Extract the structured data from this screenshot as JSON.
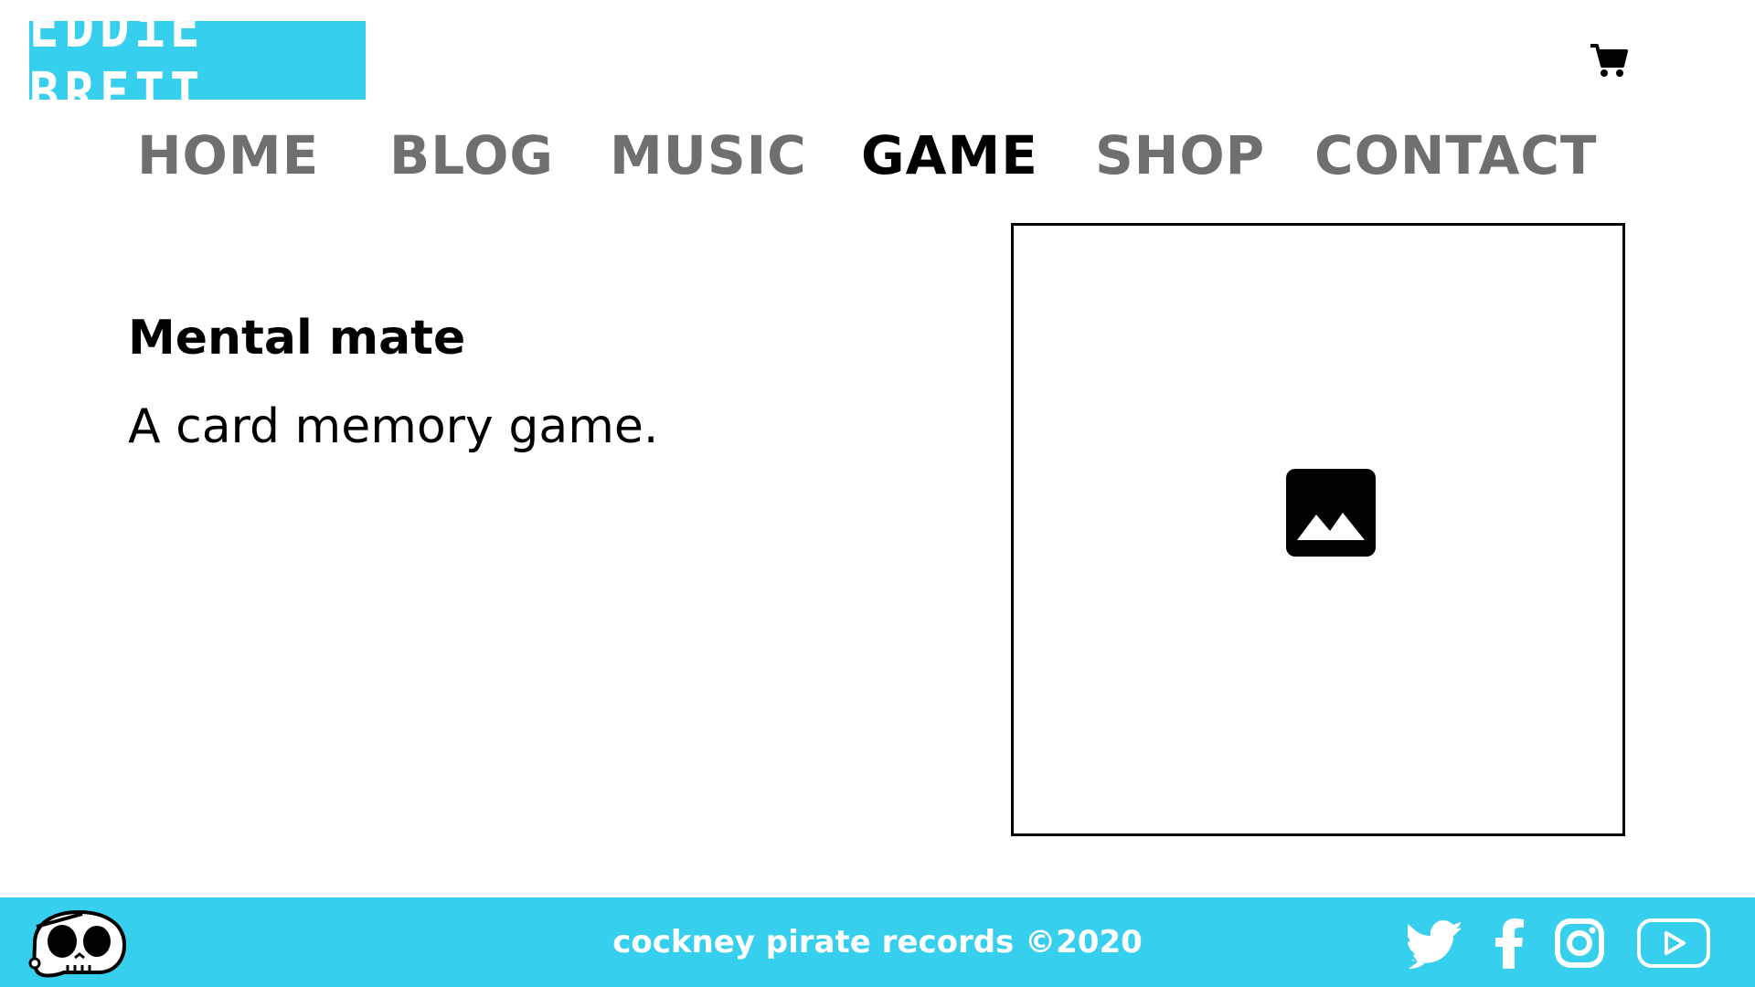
{
  "header": {
    "logo_text": "EDDiE BRETT",
    "cart_icon": "cart-icon",
    "brand_color": "#37cfee"
  },
  "nav": {
    "items": [
      {
        "label": "HOME",
        "active": false
      },
      {
        "label": "BLOG",
        "active": false
      },
      {
        "label": "MUSIC",
        "active": false
      },
      {
        "label": "GAME",
        "active": true
      },
      {
        "label": "SHOP",
        "active": false
      },
      {
        "label": "CONTACT",
        "active": false
      }
    ],
    "inactive_color": "#6f6f6f",
    "active_color": "#000000"
  },
  "main": {
    "title": "Mental mate",
    "description": "A card memory game.",
    "media_icon": "image-placeholder-icon"
  },
  "footer": {
    "copyright": "cockney pirate records ©2020",
    "mascot_icon": "skull-mascot-icon",
    "social": [
      "twitter-icon",
      "facebook-icon",
      "instagram-icon",
      "youtube-icon"
    ]
  }
}
